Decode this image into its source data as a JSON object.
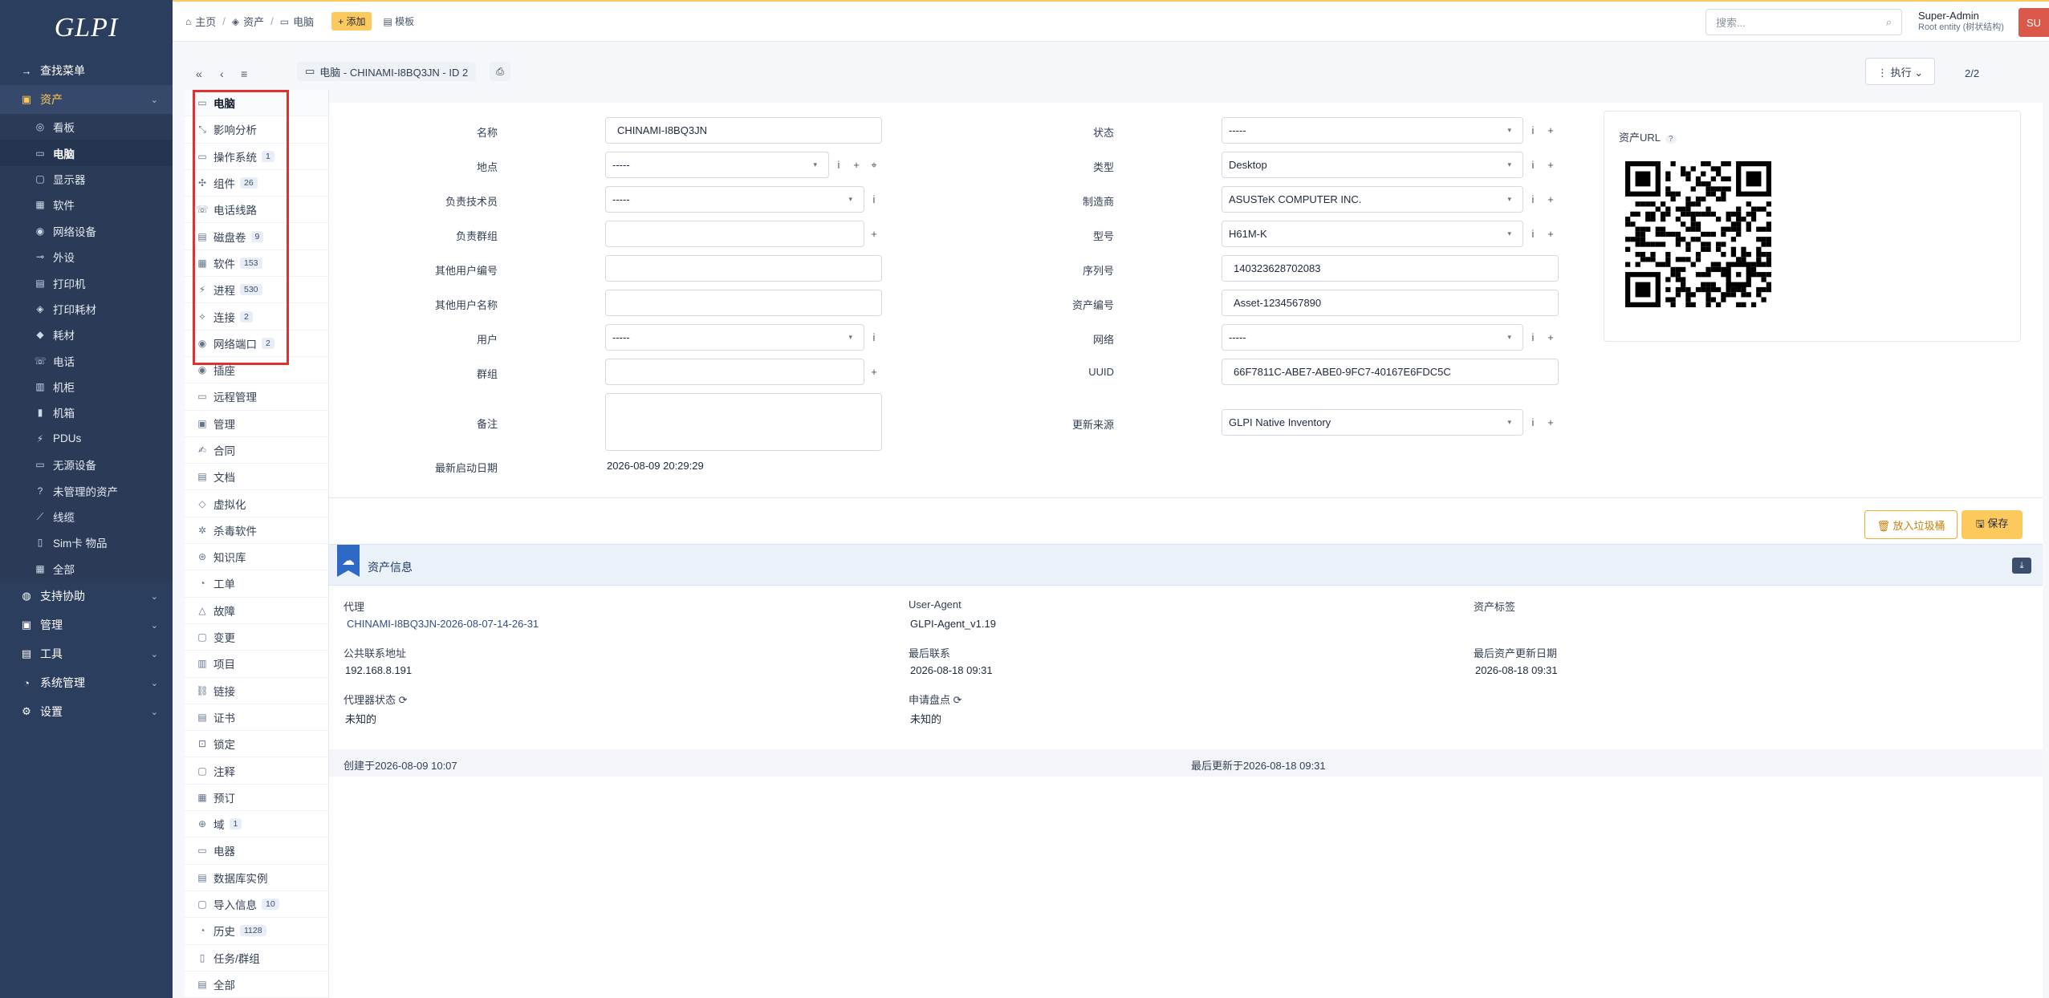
{
  "app": {
    "logo": "GLPI"
  },
  "sidebar": {
    "tops": [
      {
        "label": "查找菜单",
        "icon": "→"
      },
      {
        "label": "资产",
        "icon": "▣"
      }
    ],
    "assets": [
      {
        "label": "看板",
        "icon": "◎"
      },
      {
        "label": "电脑",
        "icon": "▭"
      },
      {
        "label": "显示器",
        "icon": "▢"
      },
      {
        "label": "软件",
        "icon": "▦"
      },
      {
        "label": "网络设备",
        "icon": "◉"
      },
      {
        "label": "外设",
        "icon": "⊸"
      },
      {
        "label": "打印机",
        "icon": "▤"
      },
      {
        "label": "打印耗材",
        "icon": "◈"
      },
      {
        "label": "耗材",
        "icon": "◆"
      },
      {
        "label": "电话",
        "icon": "☏"
      },
      {
        "label": "机柜",
        "icon": "▥"
      },
      {
        "label": "机箱",
        "icon": "▮"
      },
      {
        "label": "PDUs",
        "icon": "⚡"
      },
      {
        "label": "无源设备",
        "icon": "▭"
      },
      {
        "label": "未管理的资产",
        "icon": "?"
      },
      {
        "label": "线缆",
        "icon": "⟋"
      },
      {
        "label": "Sim卡 物品",
        "icon": "▯"
      },
      {
        "label": "全部",
        "icon": "▦"
      }
    ],
    "bottoms": [
      {
        "label": "支持协助",
        "icon": "◍"
      },
      {
        "label": "管理",
        "icon": "▣"
      },
      {
        "label": "工具",
        "icon": "▤"
      },
      {
        "label": "系统管理",
        "icon": "◔"
      },
      {
        "label": "设置",
        "icon": "⚙"
      }
    ],
    "chevron": "⌄"
  },
  "header": {
    "crumbs": [
      {
        "label": "主页",
        "icon": "⌂"
      },
      {
        "label": "资产",
        "icon": "◈"
      },
      {
        "label": "电脑",
        "icon": "▭"
      }
    ],
    "sep": "/",
    "add_label": "+ 添加",
    "templates_label": "▤ 模板",
    "search_placeholder": "搜索...",
    "search_icon": "⌕",
    "user_name": "Super-Admin",
    "user_entity": "Root entity (树状结构)",
    "avatar": "SU"
  },
  "toolbar": {
    "first": "«",
    "prev": "‹",
    "list": "≡",
    "title_icon": "▭",
    "title": "电脑 - CHINAMI-I8BQ3JN - ID 2",
    "print_icon": "⎙",
    "actions_label": "⋮ 执行 ⌄",
    "pager": "2/2"
  },
  "tabs": [
    {
      "label": "电脑",
      "icon": "▭",
      "count": ""
    },
    {
      "label": "影响分析",
      "icon": "⤡",
      "count": ""
    },
    {
      "label": "操作系统",
      "icon": "▭",
      "count": "1"
    },
    {
      "label": "组件",
      "icon": "✣",
      "count": "26"
    },
    {
      "label": "电话线路",
      "icon": "☏",
      "count": ""
    },
    {
      "label": "磁盘卷",
      "icon": "▤",
      "count": "9"
    },
    {
      "label": "软件",
      "icon": "▦",
      "count": "153"
    },
    {
      "label": "进程",
      "icon": "⚡",
      "count": "530"
    },
    {
      "label": "连接",
      "icon": "⟡",
      "count": "2"
    },
    {
      "label": "网络端口",
      "icon": "◉",
      "count": "2"
    },
    {
      "label": "插座",
      "icon": "◉",
      "count": ""
    },
    {
      "label": "远程管理",
      "icon": "▭",
      "count": ""
    },
    {
      "label": "管理",
      "icon": "▣",
      "count": ""
    },
    {
      "label": "合同",
      "icon": "✍",
      "count": ""
    },
    {
      "label": "文档",
      "icon": "▤",
      "count": ""
    },
    {
      "label": "虚拟化",
      "icon": "◇",
      "count": ""
    },
    {
      "label": "杀毒软件",
      "icon": "✲",
      "count": ""
    },
    {
      "label": "知识库",
      "icon": "⊛",
      "count": ""
    },
    {
      "label": "工单",
      "icon": "◔",
      "count": ""
    },
    {
      "label": "故障",
      "icon": "△",
      "count": ""
    },
    {
      "label": "变更",
      "icon": "▢",
      "count": ""
    },
    {
      "label": "项目",
      "icon": "▥",
      "count": ""
    },
    {
      "label": "链接",
      "icon": "⛓",
      "count": ""
    },
    {
      "label": "证书",
      "icon": "▤",
      "count": ""
    },
    {
      "label": "锁定",
      "icon": "⊡",
      "count": ""
    },
    {
      "label": "注释",
      "icon": "▢",
      "count": ""
    },
    {
      "label": "预订",
      "icon": "▦",
      "count": ""
    },
    {
      "label": "域",
      "icon": "⊕",
      "count": "1"
    },
    {
      "label": "电器",
      "icon": "▭",
      "count": ""
    },
    {
      "label": "数据库实例",
      "icon": "▤",
      "count": ""
    },
    {
      "label": "导入信息",
      "icon": "▢",
      "count": "10"
    },
    {
      "label": "历史",
      "icon": "◔",
      "count": "1128"
    },
    {
      "label": "任务/群组",
      "icon": "▯",
      "count": ""
    },
    {
      "label": "全部",
      "icon": "▤",
      "count": ""
    }
  ],
  "form": {
    "left": [
      {
        "label": "名称",
        "value": "CHINAMI-I8BQ3JN",
        "kind": "text",
        "icons": []
      },
      {
        "label": "地点",
        "value": "-----",
        "kind": "select",
        "icons": [
          "i",
          "+",
          "⌖"
        ]
      },
      {
        "label": "负责技术员",
        "value": "-----",
        "kind": "select",
        "icons": [
          "i"
        ]
      },
      {
        "label": "负责群组",
        "value": "",
        "kind": "text",
        "icons": [
          "+"
        ]
      },
      {
        "label": "其他用户编号",
        "value": "",
        "kind": "text",
        "icons": []
      },
      {
        "label": "其他用户名称",
        "value": "",
        "kind": "text",
        "icons": []
      },
      {
        "label": "用户",
        "value": "-----",
        "kind": "select",
        "icons": [
          "i"
        ]
      },
      {
        "label": "群组",
        "value": "",
        "kind": "text",
        "icons": [
          "+"
        ]
      },
      {
        "label": "备注",
        "value": "",
        "kind": "textarea",
        "icons": []
      },
      {
        "label": "最新启动日期",
        "value": "2026-08-09 20:29:29",
        "kind": "static",
        "icons": []
      }
    ],
    "right": [
      {
        "label": "状态",
        "value": "-----",
        "kind": "select",
        "icons": [
          "i",
          "+"
        ]
      },
      {
        "label": "类型",
        "value": "Desktop",
        "kind": "select",
        "icons": [
          "i",
          "+"
        ]
      },
      {
        "label": "制造商",
        "value": "ASUSTeK COMPUTER INC.",
        "kind": "select",
        "icons": [
          "i",
          "+"
        ]
      },
      {
        "label": "型号",
        "value": "H61M-K",
        "kind": "select",
        "icons": [
          "i",
          "+"
        ]
      },
      {
        "label": "序列号",
        "value": "140323628702083",
        "kind": "text",
        "icons": []
      },
      {
        "label": "资产编号",
        "value": "Asset-1234567890",
        "kind": "text",
        "icons": []
      },
      {
        "label": "网络",
        "value": "-----",
        "kind": "select",
        "icons": [
          "i",
          "+"
        ]
      },
      {
        "label": "UUID",
        "value": "66F7811C-ABE7-ABE0-9FC7-40167E6FDC5C",
        "kind": "text",
        "icons": []
      },
      {
        "label": "更新来源",
        "value": "GLPI Native Inventory",
        "kind": "select",
        "icons": [
          "i",
          "+"
        ]
      }
    ],
    "qr_label": "资产URL",
    "qr_help": "?",
    "caret": "▾",
    "trash_label": "🗑 放入垃圾桶",
    "save_label": "🖫 保存"
  },
  "inventory": {
    "title": "资产信息",
    "badge_icon": "☁",
    "download_icon": "⤓",
    "fields": [
      {
        "label": "代理",
        "value": "CHINAMI-I8BQ3JN-2026-08-07-14-26-31",
        "link": true
      },
      {
        "label": "User-Agent",
        "value": "GLPI-Agent_v1.19",
        "link": false
      },
      {
        "label": "资产标签",
        "value": "",
        "link": false
      },
      {
        "label": "公共联系地址",
        "value": "192.168.8.191",
        "link": false
      },
      {
        "label": "最后联系",
        "value": "2026-08-18 09:31",
        "link": false
      },
      {
        "label": "最后资产更新日期",
        "value": "2026-08-18 09:31",
        "link": false
      },
      {
        "label": "代理器状态 ⟳",
        "value": "未知的",
        "link": false
      },
      {
        "label": "申请盘点 ⟳",
        "value": "未知的",
        "link": false
      }
    ],
    "created": "创建于2026-08-09 10:07",
    "updated": "最后更新于2026-08-18 09:31"
  }
}
